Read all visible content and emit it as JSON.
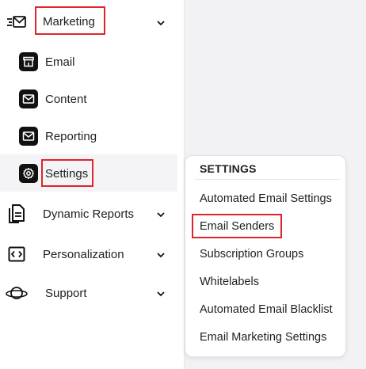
{
  "sidebar": {
    "marketing": {
      "label": "Marketing",
      "icon": "megaphone-mail-icon"
    },
    "sub_items": [
      {
        "label": "Email",
        "icon": "storefront-icon"
      },
      {
        "label": "Content",
        "icon": "mail-icon"
      },
      {
        "label": "Reporting",
        "icon": "mail-icon"
      },
      {
        "label": "Settings",
        "icon": "gear-icon"
      }
    ],
    "dynamic_reports": {
      "label": "Dynamic Reports",
      "icon": "document-icon"
    },
    "personalization": {
      "label": "Personalization",
      "icon": "code-icon"
    },
    "support": {
      "label": "Support",
      "icon": "planet-icon"
    }
  },
  "settings_menu": {
    "header": "SETTINGS",
    "items": [
      "Automated Email Settings",
      "Email Senders",
      "Subscription Groups",
      "Whitelabels",
      "Automated Email Blacklist",
      "Email Marketing Settings"
    ]
  },
  "colors": {
    "highlight": "#e0252a",
    "icon_dark": "#111111",
    "right_pane": "#f2f2f4"
  }
}
